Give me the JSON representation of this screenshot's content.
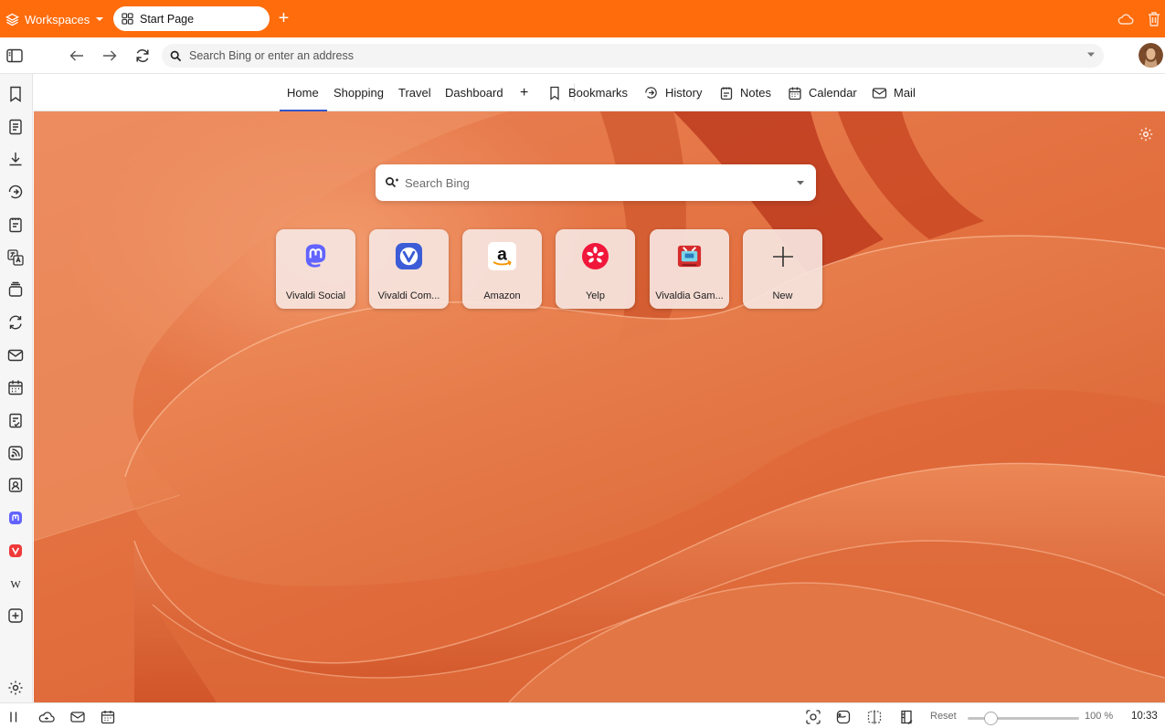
{
  "tabbar": {
    "workspaces_label": "Workspaces",
    "active_tab": "Start Page",
    "accent": "#fe6c0c"
  },
  "addressbar": {
    "placeholder": "Search Bing or enter an address"
  },
  "startpage_nav": {
    "items": [
      "Home",
      "Shopping",
      "Travel",
      "Dashboard"
    ],
    "active": "Home",
    "shortcuts": [
      "Bookmarks",
      "History",
      "Notes",
      "Calendar",
      "Mail"
    ]
  },
  "search": {
    "placeholder": "Search Bing"
  },
  "speed_dials": [
    {
      "label": "Vivaldi Social",
      "icon": "mastodon-icon"
    },
    {
      "label": "Vivaldi Com...",
      "icon": "vivaldi-icon"
    },
    {
      "label": "Amazon",
      "icon": "amazon-icon"
    },
    {
      "label": "Yelp",
      "icon": "yelp-icon"
    },
    {
      "label": "Vivaldia Gam...",
      "icon": "vivaldia-game-icon"
    },
    {
      "label": "New",
      "icon": "plus-icon"
    }
  ],
  "statusbar": {
    "reset_label": "Reset",
    "zoom": "100 %",
    "zoom_value": 100,
    "clock": "10:33"
  }
}
